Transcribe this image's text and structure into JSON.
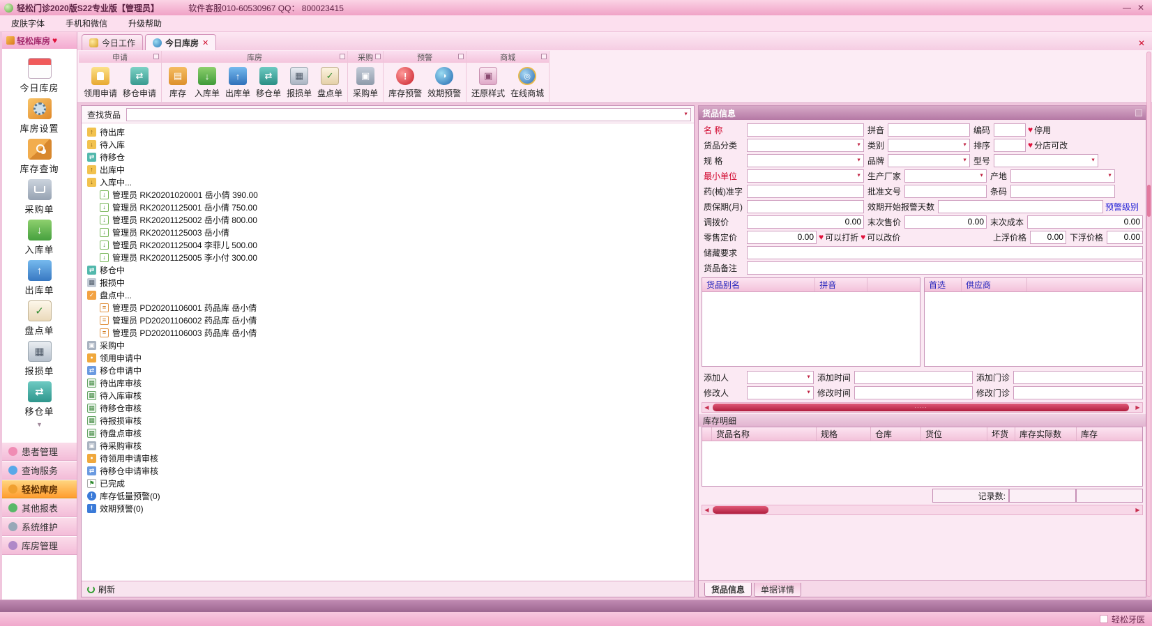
{
  "titlebar": {
    "title": "轻松门诊2020版S22专业版【管理员】",
    "support": "软件客服010-60530967 QQ： 800023415",
    "minimize": "—",
    "close": "✕"
  },
  "menubar": {
    "items": [
      {
        "label": "皮肤字体"
      },
      {
        "label": "手机和微信"
      },
      {
        "label": "升级帮助"
      }
    ]
  },
  "sidebar": {
    "header": "轻松库房",
    "items": [
      {
        "icon": "icon-calendar",
        "label": "今日库房"
      },
      {
        "icon": "icon-settings",
        "label": "库房设置"
      },
      {
        "icon": "icon-stock-query",
        "label": "库存查询"
      },
      {
        "icon": "icon-purchase",
        "label": "采购单"
      },
      {
        "icon": "icon-inbound",
        "label": "入库单"
      },
      {
        "icon": "icon-outbound",
        "label": "出库单"
      },
      {
        "icon": "icon-count",
        "label": "盘点单"
      },
      {
        "icon": "icon-damage",
        "label": "报损单"
      },
      {
        "icon": "icon-transfer",
        "label": "移仓单"
      }
    ],
    "groups": [
      {
        "icon": "gi-patient",
        "label": "患者管理",
        "cls": ""
      },
      {
        "icon": "gi-query",
        "label": "查询服务",
        "cls": ""
      },
      {
        "icon": "gi-warehouse",
        "label": "轻松库房",
        "cls": "active"
      },
      {
        "icon": "gi-report",
        "label": "其他报表",
        "cls": ""
      },
      {
        "icon": "gi-system",
        "label": "系统维护",
        "cls": ""
      },
      {
        "icon": "gi-manage",
        "label": "库房管理",
        "cls": ""
      }
    ]
  },
  "tabs": [
    {
      "icon": "tab-work-icon",
      "label": "今日工作",
      "cls": ""
    },
    {
      "icon": "tab-warehouse-icon",
      "label": "今日库房",
      "cls": "active",
      "close": "✕"
    }
  ],
  "ribbon": {
    "g0": {
      "title": "申请",
      "buttons": [
        {
          "icon": "ri-requisition",
          "label": "领用申请"
        },
        {
          "icon": "ri-transfer-apply",
          "label": "移仓申请"
        }
      ]
    },
    "g1": {
      "title": "库房",
      "buttons": [
        {
          "icon": "ri-stock",
          "label": "库存"
        },
        {
          "icon": "ri-inbound",
          "label": "入库单"
        },
        {
          "icon": "ri-outbound",
          "label": "出库单"
        },
        {
          "icon": "ri-transfer",
          "label": "移仓单"
        },
        {
          "icon": "ri-damage",
          "label": "报损单"
        },
        {
          "icon": "ri-count",
          "label": "盘点单"
        }
      ]
    },
    "g2": {
      "title": "采购",
      "buttons": [
        {
          "icon": "ri-purchase",
          "label": "采购单"
        }
      ]
    },
    "g3": {
      "title": "预警",
      "buttons": [
        {
          "icon": "ri-stock-warning",
          "label": "库存预警"
        },
        {
          "icon": "ri-expiry-warning",
          "label": "效期预警"
        }
      ]
    },
    "g4": {
      "title": "商城",
      "buttons": [
        {
          "icon": "ri-restore",
          "label": "还原样式"
        },
        {
          "icon": "ri-mall",
          "label": "在线商城"
        }
      ]
    }
  },
  "tree": {
    "search_label": "查找货品",
    "refresh_label": "刷新",
    "nodes": [
      {
        "icon": "ti-out-pending",
        "lv": "lv0",
        "label": "待出库"
      },
      {
        "icon": "ti-in-pending",
        "lv": "lv0",
        "label": "待入库"
      },
      {
        "icon": "ti-move-pending",
        "lv": "lv0",
        "label": "待移仓"
      },
      {
        "icon": "ti-out-active",
        "lv": "lv0",
        "label": "出库中"
      },
      {
        "icon": "ti-in-active",
        "lv": "lv0",
        "label": "入库中..."
      },
      {
        "icon": "ti-in-doc",
        "lv": "lv1",
        "label": "管理员 RK20201020001 岳小倩  390.00"
      },
      {
        "icon": "ti-in-doc",
        "lv": "lv1",
        "label": "管理员 RK20201125001 岳小倩  750.00"
      },
      {
        "icon": "ti-in-doc",
        "lv": "lv1",
        "label": "管理员 RK20201125002 岳小倩  800.00"
      },
      {
        "icon": "ti-in-doc",
        "lv": "lv1",
        "label": "管理员 RK20201125003 岳小倩"
      },
      {
        "icon": "ti-in-doc",
        "lv": "lv1",
        "label": "管理员 RK20201125004 李菲儿  500.00"
      },
      {
        "icon": "ti-in-doc",
        "lv": "lv1",
        "label": "管理员 RK20201125005 李小付  300.00"
      },
      {
        "icon": "ti-move-active",
        "lv": "lv0",
        "label": "移仓中"
      },
      {
        "icon": "ti-damage-active",
        "lv": "lv0",
        "label": "报损中"
      },
      {
        "icon": "ti-count-active",
        "lv": "lv0",
        "label": "盘点中..."
      },
      {
        "icon": "ti-count-doc",
        "lv": "lv1",
        "label": "管理员 PD20201106001 药品库 岳小倩"
      },
      {
        "icon": "ti-count-doc",
        "lv": "lv1",
        "label": "管理员 PD20201106002 药品库 岳小倩"
      },
      {
        "icon": "ti-count-doc",
        "lv": "lv1",
        "label": "管理员 PD20201106003 药品库 岳小倩"
      },
      {
        "icon": "ti-purchase-active",
        "lv": "lv0",
        "label": "采购中"
      },
      {
        "icon": "ti-requisition-active",
        "lv": "lv0",
        "label": "领用申请中"
      },
      {
        "icon": "ti-move-apply-active",
        "lv": "lv0",
        "label": "移仓申请中"
      },
      {
        "icon": "ti-audit",
        "lv": "lv0",
        "label": "待出库审核"
      },
      {
        "icon": "ti-audit",
        "lv": "lv0",
        "label": "待入库审核"
      },
      {
        "icon": "ti-audit",
        "lv": "lv0",
        "label": "待移仓审核"
      },
      {
        "icon": "ti-audit",
        "lv": "lv0",
        "label": "待报损审核"
      },
      {
        "icon": "ti-audit",
        "lv": "lv0",
        "label": "待盘点审核"
      },
      {
        "icon": "ti-audit-purchase",
        "lv": "lv0",
        "label": "待采购审核"
      },
      {
        "icon": "ti-audit-req",
        "lv": "lv0",
        "label": "待领用申请审核"
      },
      {
        "icon": "ti-audit-move",
        "lv": "lv0",
        "label": "待移仓申请审核"
      },
      {
        "icon": "ti-done",
        "lv": "lv0",
        "label": "已完成"
      },
      {
        "icon": "ti-low-stock-warning",
        "lv": "lv0",
        "label": "库存低量预警(0)"
      },
      {
        "icon": "ti-expiry-warning",
        "lv": "lv0",
        "label": "效期预警(0)"
      }
    ]
  },
  "info": {
    "title": "货品信息",
    "labels": {
      "name": "名 称",
      "pinyin": "拼音",
      "code": "编码",
      "disabled": "停用",
      "category": "货品分类",
      "type": "类别",
      "sort": "排序",
      "branch_editable": "分店可改",
      "spec": "规 格",
      "brand": "品牌",
      "model": "型号",
      "min_unit": "最小单位",
      "manufacturer": "生产厂家",
      "origin": "产地",
      "approval": "药(械)准字",
      "approval_no": "批准文号",
      "barcode": "条码",
      "warranty_month": "质保期(月)",
      "expiry_alert_days": "效期开始报警天数",
      "alert_level": "预警级别",
      "transfer_price": "调拨价",
      "last_sell_price": "末次售价",
      "last_cost": "末次成本",
      "retail_price": "零售定价",
      "can_discount": "可以打折",
      "can_change_price": "可以改价",
      "float_up": "上浮价格",
      "float_down": "下浮价格",
      "storage": "储藏要求",
      "remark": "货品备注",
      "alias": "货品别名",
      "alias_pinyin": "拼音",
      "preferred": "首选",
      "supplier": "供应商",
      "added_by": "添加人",
      "added_time": "添加时间",
      "added_clinic": "添加门诊",
      "modified_by": "修改人",
      "modified_time": "修改时间",
      "modified_clinic": "修改门诊"
    },
    "values": {
      "transfer_price": "0.00",
      "last_sell_price": "0.00",
      "last_cost": "0.00",
      "retail_price": "0.00",
      "float_up": "0.00",
      "float_down": "0.00"
    },
    "stock": {
      "title": "库存明细",
      "headers": [
        {
          "label": "",
          "cls": "c0"
        },
        {
          "label": "货品名称",
          "cls": "c1"
        },
        {
          "label": "规格",
          "cls": "c2"
        },
        {
          "label": "仓库",
          "cls": "c3"
        },
        {
          "label": "货位",
          "cls": "c4"
        },
        {
          "label": "坏货",
          "cls": "c5"
        },
        {
          "label": "库存实际数",
          "cls": "c6"
        },
        {
          "label": "库存",
          "cls": "fill"
        }
      ],
      "record_label": "记录数:"
    },
    "bottom_tabs": [
      {
        "label": "货品信息",
        "cls": "active"
      },
      {
        "label": "单据详情",
        "cls": ""
      }
    ]
  },
  "statusbar": {
    "right": "轻松牙医"
  },
  "icons": {
    "dropdown": "▼",
    "heart": "♥",
    "close": "✕",
    "minimize": "—",
    "scroll_left": "◀",
    "scroll_right": "▶",
    "refresh": "circular-arrow"
  }
}
